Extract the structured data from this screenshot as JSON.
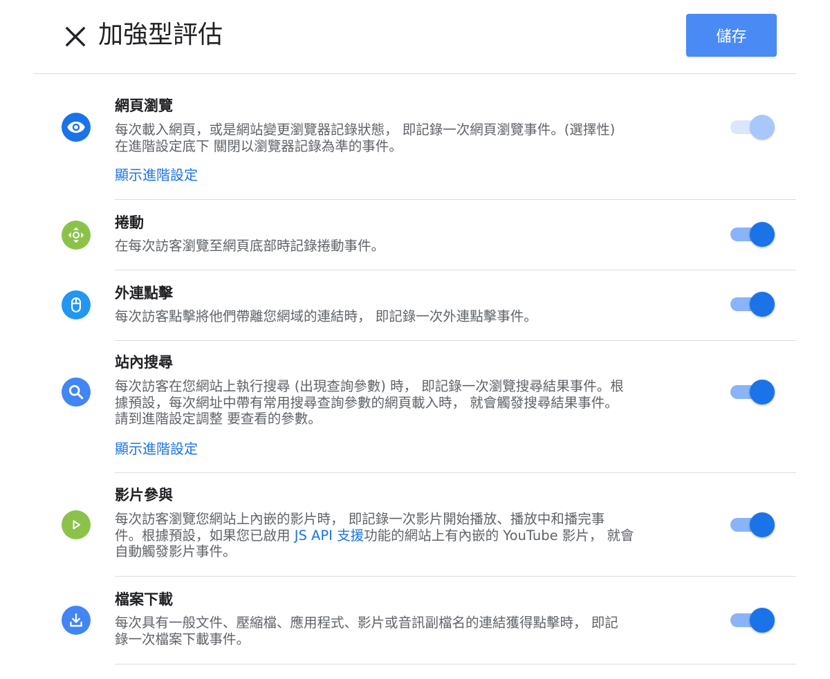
{
  "header": {
    "title": "加強型評估",
    "save_label": "儲存"
  },
  "colors": {
    "primary_blue": "#1a73e8",
    "save_button": "#4a8af4",
    "green_icon": "#8bc34a",
    "light_blue_icon": "#2196f3"
  },
  "rows": [
    {
      "icon": "eye-icon",
      "title": "網頁瀏覽",
      "desc_line1": "每次載入網頁，或是網站變更瀏覽器記錄狀態， 即記錄一次網頁瀏覽事件。(選擇性)",
      "desc_line2": "在進階設定底下 關閉以瀏覽器記錄為準的事件。",
      "advanced_link": "顯示進階設定",
      "toggle_state": "on-disabled"
    },
    {
      "icon": "scroll-icon",
      "title": "捲動",
      "desc_line1": "在每次訪客瀏覽至網頁底部時記錄捲動事件。",
      "toggle_state": "on"
    },
    {
      "icon": "mouse-icon",
      "title": "外連點擊",
      "desc_line1": "每次訪客點擊將他們帶離您網域的連結時， 即記錄一次外連點擊事件。",
      "toggle_state": "on"
    },
    {
      "icon": "search-icon",
      "title": "站內搜尋",
      "desc_line1": "每次訪客在您網站上執行搜尋 (出現查詢參數) 時， 即記錄一次瀏覽搜尋結果事件。根",
      "desc_line2": "據預設，每次網址中帶有常用搜尋查詢參數的網頁載入時， 就會觸發搜尋結果事件。",
      "desc_line3": "請到進階設定調整 要查看的參數。",
      "advanced_link": "顯示進階設定",
      "toggle_state": "on"
    },
    {
      "icon": "play-icon",
      "title": "影片參與",
      "desc_line1": "每次訪客瀏覽您網站上內嵌的影片時， 即記錄一次影片開始播放、播放中和播完事",
      "desc_line2_before": "件。根據預設，如果您已啟用 ",
      "desc_line2_link": "JS API 支援",
      "desc_line2_after": "功能的網站上有內嵌的 YouTube 影片， 就會",
      "desc_line3": "自動觸發影片事件。",
      "toggle_state": "on"
    },
    {
      "icon": "download-icon",
      "title": "檔案下載",
      "desc_line1": "每次具有一般文件、壓縮檔、應用程式、影片或音訊副檔名的連結獲得點擊時， 即記",
      "desc_line2": "錄一次檔案下載事件。",
      "toggle_state": "on"
    }
  ]
}
